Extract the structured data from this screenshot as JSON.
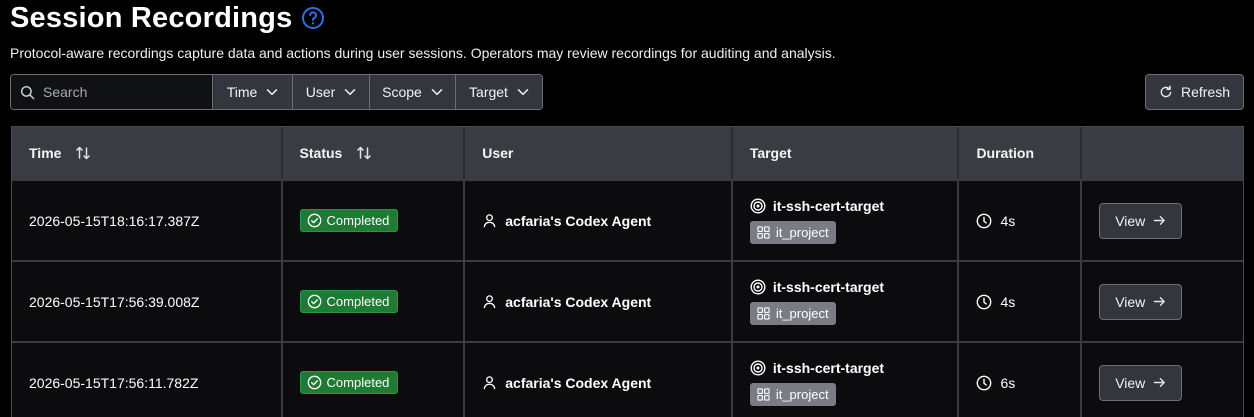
{
  "page": {
    "title": "Session Recordings",
    "description": "Protocol-aware recordings capture data and actions during user sessions. Operators may review recordings for auditing and analysis."
  },
  "toolbar": {
    "search_placeholder": "Search",
    "filters": {
      "time": "Time",
      "user": "User",
      "scope": "Scope",
      "target": "Target"
    },
    "refresh_label": "Refresh"
  },
  "table": {
    "headers": {
      "time": "Time",
      "status": "Status",
      "user": "User",
      "target": "Target",
      "duration": "Duration"
    },
    "rows": [
      {
        "time": "2026-05-15T18:16:17.387Z",
        "status": "Completed",
        "user": "acfaria's Codex Agent",
        "target": "it-ssh-cert-target",
        "scope": "it_project",
        "duration": "4s",
        "action": "View"
      },
      {
        "time": "2026-05-15T17:56:39.008Z",
        "status": "Completed",
        "user": "acfaria's Codex Agent",
        "target": "it-ssh-cert-target",
        "scope": "it_project",
        "duration": "4s",
        "action": "View"
      },
      {
        "time": "2026-05-15T17:56:11.782Z",
        "status": "Completed",
        "user": "acfaria's Codex Agent",
        "target": "it-ssh-cert-target",
        "scope": "it_project",
        "duration": "6s",
        "action": "View"
      }
    ]
  },
  "icons": {
    "help": "question-circle-icon",
    "search": "search-icon",
    "chevron": "chevron-down-icon",
    "refresh": "refresh-icon",
    "sort": "sort-icon",
    "status": "check-circle-icon",
    "user": "user-icon",
    "target": "target-icon",
    "scope": "grid-icon",
    "duration": "clock-icon",
    "view": "arrow-right-icon"
  },
  "colors": {
    "background": "#000000",
    "accent_help": "#2f6fe0",
    "status_success": "#1f7a34",
    "header_row": "#3a3c44",
    "scope_badge": "#7a7c84"
  }
}
